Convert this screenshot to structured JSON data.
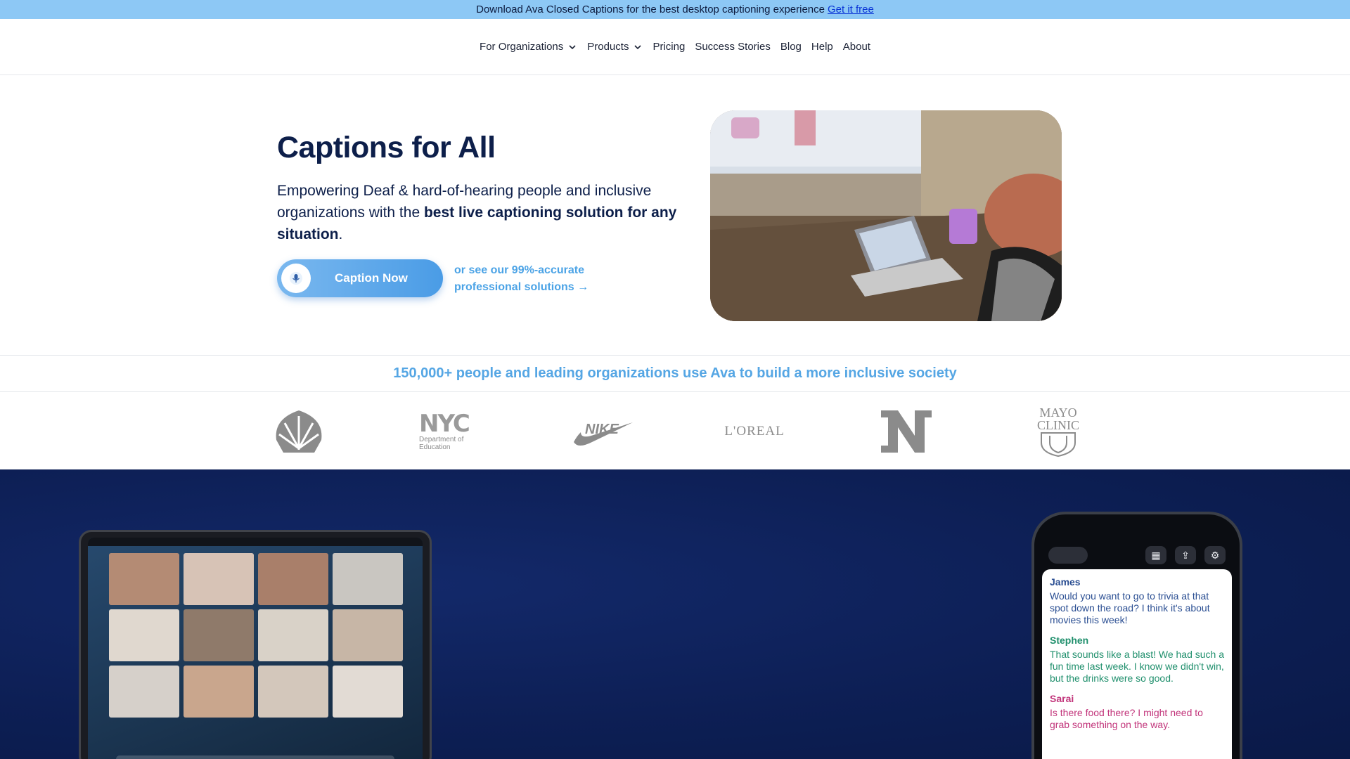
{
  "banner": {
    "text": "Download Ava Closed Captions for the best desktop captioning experience",
    "link": "Get it free"
  },
  "nav": {
    "items": [
      {
        "label": "For Organizations",
        "dropdown": true
      },
      {
        "label": "Products",
        "dropdown": true
      },
      {
        "label": "Pricing"
      },
      {
        "label": "Success Stories"
      },
      {
        "label": "Blog"
      },
      {
        "label": "Help"
      },
      {
        "label": "About"
      }
    ]
  },
  "hero": {
    "title": "Captions for All",
    "subtitle_plain": "Empowering Deaf & hard-of-hearing people and inclusive organizations with the ",
    "subtitle_bold": "best live captioning solution for any situation",
    "subtitle_end": ".",
    "cta": "Caption Now",
    "secondary_link": "or see our 99%-accurate professional solutions →"
  },
  "proof": {
    "headline": "150,000+ people and leading organizations use Ava to build a more inclusive society",
    "logos": [
      "shell-logo",
      "nyc-doe-logo",
      "nike-logo",
      "loreal-logo",
      "notre-dame-logo",
      "mayo-clinic-logo"
    ],
    "nyc_line1": "Department of",
    "nyc_line2": "Education",
    "loreal": "L'OREAL",
    "mayo_line1": "MAYO",
    "mayo_line2": "CLINIC"
  },
  "phone": {
    "messages": [
      {
        "speaker": "James",
        "text": "Would you want to go to trivia at that spot down the road? I think it's about movies this week!",
        "color": "#2a4e92"
      },
      {
        "speaker": "Stephen",
        "text": "That sounds like a blast! We had such a fun time last week. I know we didn't win, but the drinks were so good.",
        "color": "#1f8f6c"
      },
      {
        "speaker": "Sarai",
        "text": "Is there food there? I might need to grab something on the way.",
        "color": "#c2357b"
      }
    ]
  },
  "colors": {
    "banner": "#8dc8f5",
    "brand_navy": "#0d1f4a",
    "accent_blue": "#4ba3e6",
    "dark_section": "#0d1f55"
  }
}
